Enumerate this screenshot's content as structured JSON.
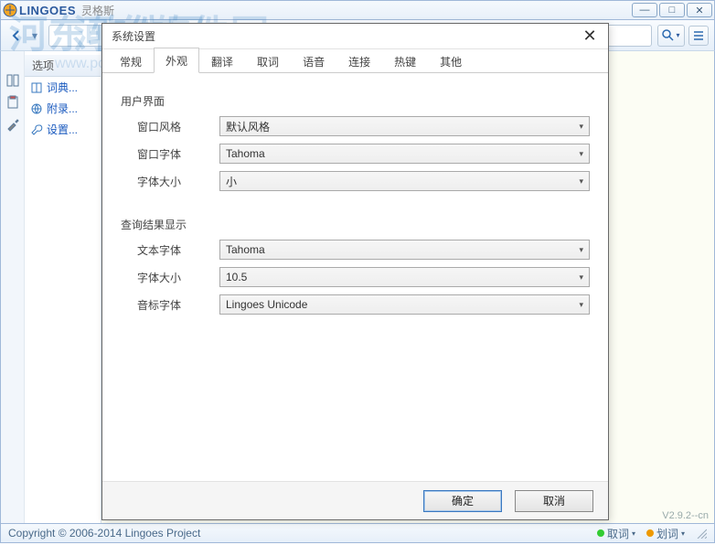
{
  "app": {
    "brand": "LINGOES",
    "brand_cn": "灵格斯"
  },
  "window": {
    "min": "—",
    "max": "□",
    "close": "✕"
  },
  "toolbar": {
    "search_placeholder": ""
  },
  "sidebar": {
    "header": "选项",
    "items": [
      {
        "label": "词典..."
      },
      {
        "label": "附录..."
      },
      {
        "label": "设置..."
      }
    ]
  },
  "dialog": {
    "title": "系统设置",
    "tabs": [
      "常规",
      "外观",
      "翻译",
      "取词",
      "语音",
      "连接",
      "热键",
      "其他"
    ],
    "active_tab": 1,
    "groups": {
      "ui": {
        "title": "用户界面",
        "fields": [
          {
            "label": "窗口风格",
            "value": "默认风格"
          },
          {
            "label": "窗口字体",
            "value": "Tahoma"
          },
          {
            "label": "字体大小",
            "value": "小"
          }
        ]
      },
      "result": {
        "title": "查询结果显示",
        "fields": [
          {
            "label": "文本字体",
            "value": "Tahoma"
          },
          {
            "label": "字体大小",
            "value": "10.5"
          },
          {
            "label": "音标字体",
            "value": "Lingoes Unicode"
          }
        ]
      }
    },
    "buttons": {
      "ok": "确定",
      "cancel": "取消"
    }
  },
  "status": {
    "copyright": "Copyright © 2006-2014 Lingoes Project",
    "pick": "取词",
    "stroke": "划词"
  },
  "version": "V2.9.2--cn",
  "watermark": {
    "big": "河东软件园",
    "url": "www.pc0359.cn"
  }
}
